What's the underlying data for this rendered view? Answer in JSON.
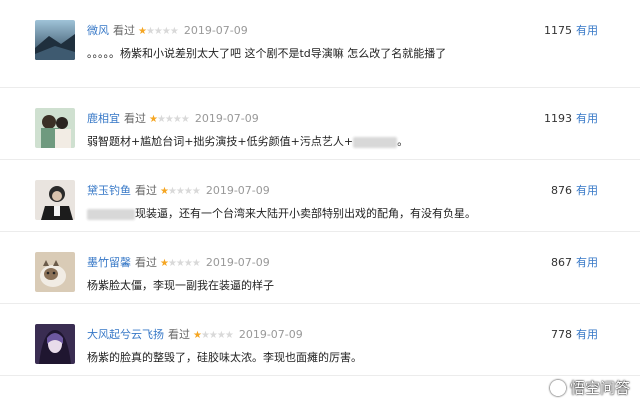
{
  "reviews": [
    {
      "user": "微风",
      "watched": "看过",
      "rating": 1,
      "date": "2019-07-09",
      "content": "。。。。。杨紫和小说差别太大了吧 这个剧不是td导演嘛 怎么改了名就能播了",
      "votes": "1175",
      "useful": "有用",
      "avatar_colors": [
        "#4a6b88",
        "#1f2f3d"
      ]
    },
    {
      "user": "鹿相宜",
      "watched": "看过",
      "rating": 1,
      "date": "2019-07-09",
      "content_before": "弱智题材+尴尬台词+拙劣演技+低劣颜值+污点艺人+",
      "content_after": "。",
      "votes": "1193",
      "useful": "有用",
      "avatar_colors": [
        "#7fa98c",
        "#3b4a3f"
      ]
    },
    {
      "user": "黛玉钓鱼",
      "watched": "看过",
      "rating": 1,
      "date": "2019-07-09",
      "content_after": "现装逼，还有一个台湾来大陆开小卖部特别出戏的配角，有没有负星。",
      "votes": "876",
      "useful": "有用",
      "avatar_colors": [
        "#2a2a2a",
        "#c9b8a8"
      ]
    },
    {
      "user": "墨竹留馨",
      "watched": "看过",
      "rating": 1,
      "date": "2019-07-09",
      "content": "杨紫脸太僵，李现一副我在装逼的样子",
      "votes": "867",
      "useful": "有用",
      "avatar_colors": [
        "#d8c9b2",
        "#6a5b4a"
      ]
    },
    {
      "user": "大风起兮云飞扬",
      "watched": "看过",
      "rating": 1,
      "date": "2019-07-09",
      "content": "杨紫的脸真的整毁了，硅胶味太浓。李现也面瘫的厉害。",
      "votes": "778",
      "useful": "有用",
      "avatar_colors": [
        "#5d4a7a",
        "#2b2140"
      ]
    }
  ],
  "watermark": {
    "text": "悟空问答",
    "icon": "wukong-logo-icon"
  },
  "colors": {
    "link": "#3778c7",
    "star_on": "#f5a623",
    "star_off": "#d9d9d9",
    "date": "#999999"
  }
}
